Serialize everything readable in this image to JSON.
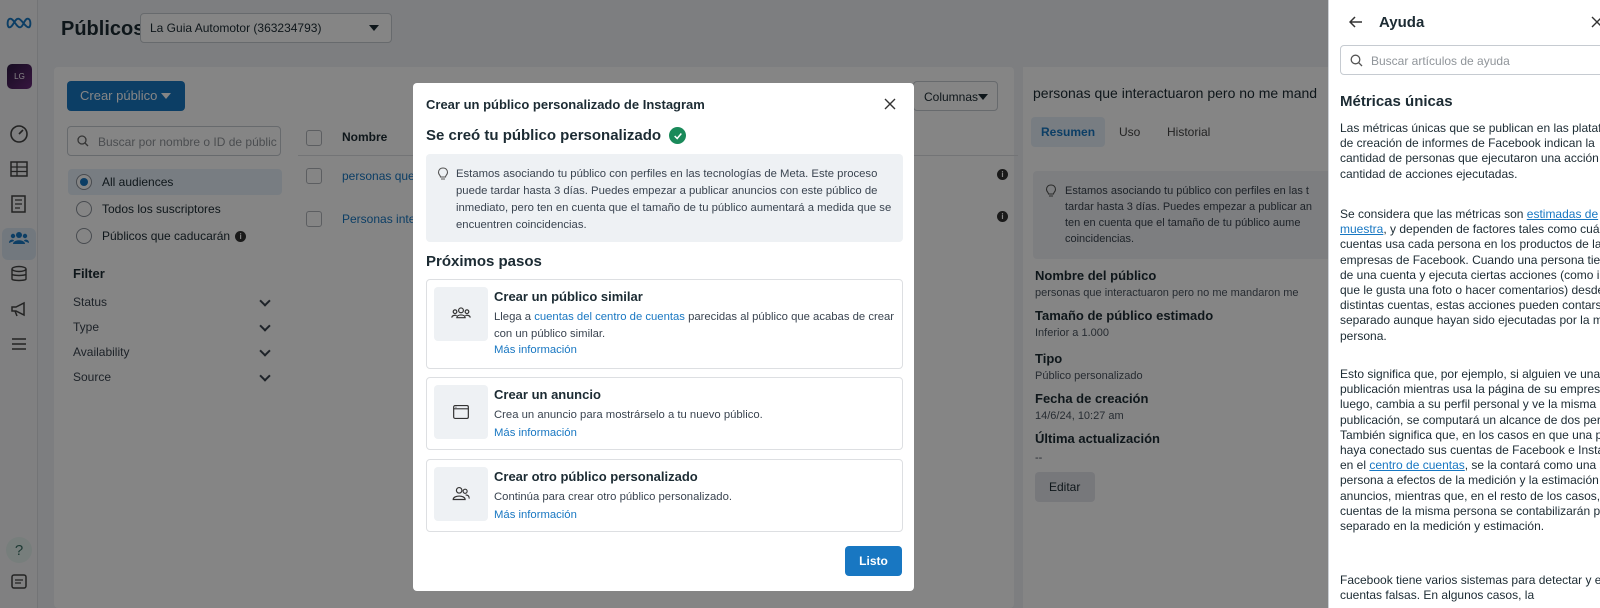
{
  "header": {
    "page_title": "Públicos",
    "account_selector": "La Guia Automotor (363234793)"
  },
  "rail": {
    "avatar_text": "LG"
  },
  "toolbar": {
    "create_button": "Crear público",
    "search_placeholder": "Buscar por nombre o ID de públic",
    "columns_button": "Columnas"
  },
  "audience_filters": [
    {
      "label": "All audiences",
      "selected": true
    },
    {
      "label": "Todos los suscriptores",
      "selected": false
    },
    {
      "label": "Públicos que caducarán",
      "selected": false
    }
  ],
  "filter": {
    "title": "Filter",
    "items": [
      "Status",
      "Type",
      "Availability",
      "Source"
    ]
  },
  "table": {
    "column_name": "Nombre",
    "rows": [
      "personas que i",
      "Personas intere"
    ]
  },
  "detail": {
    "title": "personas que interactuaron pero no me mand",
    "tabs": [
      "Resumen",
      "Uso",
      "Historial"
    ],
    "info_lines": [
      "Estamos asociando tu público con perfiles en las t",
      "tardar hasta 3 días. Puedes empezar a publicar an",
      "ten en cuenta que el tamaño de tu público aume",
      "coincidencias."
    ],
    "fields": [
      {
        "label": "Nombre del público",
        "value": "personas que interactuaron pero no me mandaron me"
      },
      {
        "label": "Tamaño de público estimado",
        "value": "Inferior a 1.000"
      },
      {
        "label": "Tipo",
        "value": "Público personalizado"
      },
      {
        "label": "Fecha de creación",
        "value": "14/6/24, 10:27 am"
      },
      {
        "label": "Última actualización",
        "value": "--"
      }
    ],
    "edit_button": "Editar"
  },
  "modal": {
    "title": "Crear un público personalizado de Instagram",
    "success_heading": "Se creó tu público personalizado",
    "info_text": "Estamos asociando tu público con perfiles en las tecnologías de Meta. Este proceso puede tardar hasta 3 días. Puedes empezar a publicar anuncios con este público de inmediato, pero ten en cuenta que el tamaño de tu público aumentará a medida que se encuentren coincidencias.",
    "next_steps_heading": "Próximos pasos",
    "cards": [
      {
        "icon": "people-group-icon",
        "title": "Crear un público similar",
        "desc_before": "Llega a ",
        "desc_link": "cuentas del centro de cuentas",
        "desc_after": " parecidas al público que acabas de crear con un público similar.",
        "more": "Más información"
      },
      {
        "icon": "ad-window-icon",
        "title": "Crear un anuncio",
        "desc": "Crea un anuncio para mostrárselo a tu nuevo público.",
        "more": "Más información"
      },
      {
        "icon": "people-pair-icon",
        "title": "Crear otro público personalizado",
        "desc": "Continúa para crear otro público personalizado.",
        "more": "Más información"
      }
    ],
    "done_button": "Listo"
  },
  "help": {
    "title": "Ayuda",
    "search_placeholder": "Buscar artículos de ayuda",
    "article_title": "Métricas únicas",
    "p1": "Las métricas únicas que se publican en las plataformas de creación de informes de Facebook indican la cantidad de personas que ejecutaron una acción, no la cantidad de acciones ejecutadas.",
    "p2_before": "Se considera que las métricas son ",
    "p2_link": "estimadas de muestra",
    "p2_after": ", y dependen de factores tales como cuántas cuentas usa cada persona en los productos de las empresas de Facebook. Cuando una persona tiene más de una cuenta y ejecuta ciertas acciones (como indicar que le gusta una foto o hacer comentarios) desde distintas cuentas, estas acciones pueden contarse por separado aunque hayan sido ejecutadas por la misma persona.",
    "p3_before": "Esto significa que, por ejemplo, si alguien ve una publicación mientras usa la página de su empresa y, luego, cambia a su perfil personal y ve la misma publicación, se computará un alcance de dos personas. También significa que, en los casos en que una persona haya conectado sus cuentas de Facebook e Instagram en el ",
    "p3_link": "centro de cuentas",
    "p3_after": ", se la contará como una sola persona a efectos de la medición y la estimación de anuncios, mientras que, en el resto de los casos, las cuentas de la misma persona se contabilizarán por separado en la medición y estimación.",
    "p4": "Facebook tiene varios sistemas para detectar y eliminar cuentas falsas. En algunos casos, la"
  }
}
